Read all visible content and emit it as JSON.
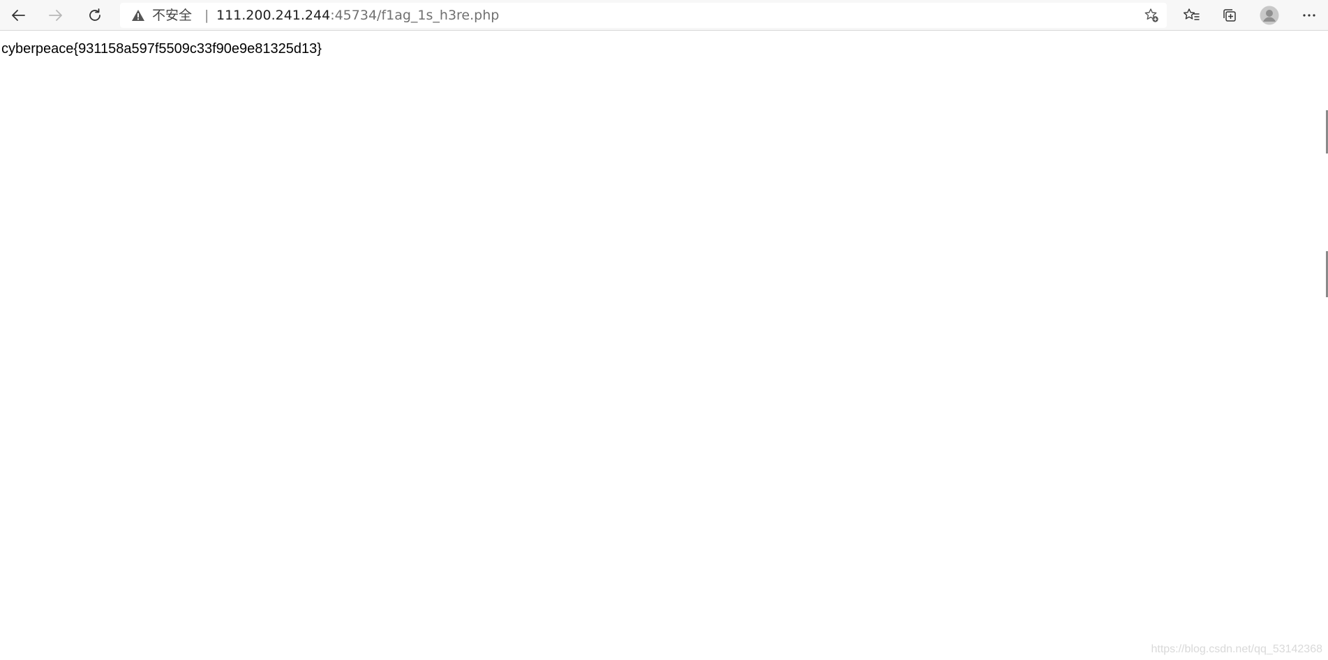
{
  "browser": {
    "nav": {
      "back_icon": "arrow-left-icon",
      "forward_icon": "arrow-right-icon",
      "refresh_icon": "refresh-icon"
    },
    "address_bar": {
      "security_label": "不安全",
      "separator": "|",
      "url_host": "111.200.241.244",
      "url_rest": ":45734/f1ag_1s_h3re.php",
      "warning_icon": "warning-triangle-icon",
      "add_favorite_icon": "star-add-icon"
    },
    "toolbar_icons": [
      "favorites-icon",
      "collections-icon",
      "profile-avatar-icon",
      "more-icon"
    ]
  },
  "page": {
    "body_text": "cyberpeace{931158a597f5509c33f90e9e81325d13}"
  },
  "watermark": "https://blog.csdn.net/qq_53142368",
  "colors": {
    "toolbar_bg": "#f7f7f7",
    "text": "#000000",
    "url_muted": "#707070"
  }
}
